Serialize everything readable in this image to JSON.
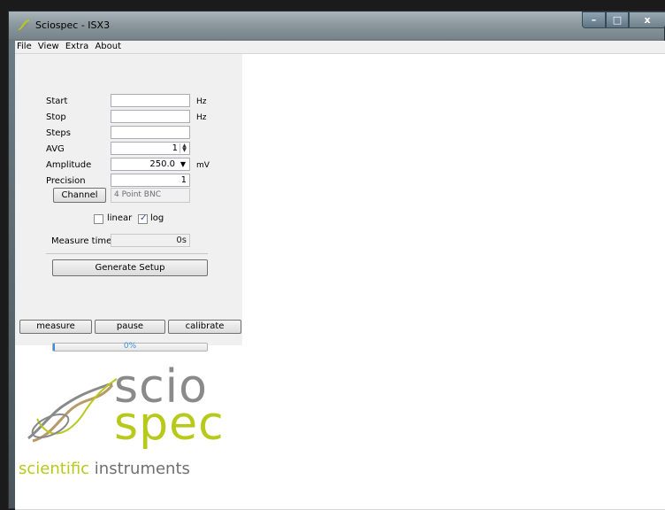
{
  "window": {
    "title": "Sciospec - ISX3",
    "controls": {
      "minimize": "–",
      "maximize": "□",
      "close": "x"
    }
  },
  "menu": [
    "File",
    "View",
    "Extra",
    "About"
  ],
  "form": {
    "start": {
      "label": "Start",
      "value": "",
      "unit": "Hz"
    },
    "stop": {
      "label": "Stop",
      "value": "",
      "unit": "Hz"
    },
    "steps": {
      "label": "Steps",
      "value": ""
    },
    "avg": {
      "label": "AVG",
      "value": "1"
    },
    "amplitude": {
      "label": "Amplitude",
      "value": "250.0",
      "unit": "mV"
    },
    "precision": {
      "label": "Precision",
      "value": "1"
    },
    "channel": {
      "button_label": "Channel",
      "value": "4 Point BNC"
    },
    "scale": {
      "linear": {
        "label": "linear",
        "checked": false
      },
      "log": {
        "label": "log",
        "checked": true
      }
    },
    "measure_time": {
      "label": "Measure time:",
      "value": "0s"
    },
    "generate_setup_label": "Generate Setup"
  },
  "actions": {
    "measure": "measure",
    "pause": "pause",
    "calibrate": "calibrate"
  },
  "progress": {
    "percent": 0,
    "text": "0%"
  },
  "logo": {
    "line1": "scio",
    "line2": "spec",
    "tagline_a": "scientific",
    "tagline_b": " instruments"
  },
  "colors": {
    "brand_green": "#b7c91a",
    "brand_gray": "#8a8a8a",
    "progress_blue": "#3b8ee0"
  }
}
